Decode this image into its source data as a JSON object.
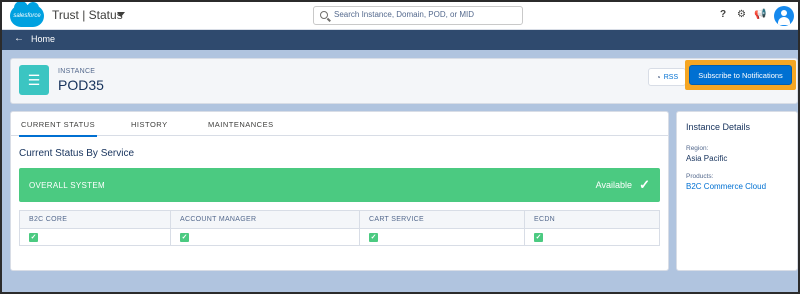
{
  "header": {
    "brand_logo": "salesforce",
    "app_title": "Trust | Status",
    "search_placeholder": "Search Instance, Domain, POD, or MID",
    "icons": [
      "help-icon",
      "gear-icon",
      "megaphone-icon",
      "avatar"
    ]
  },
  "nav": {
    "back_label": "Home"
  },
  "instance": {
    "label": "INSTANCE",
    "name": "POD35",
    "rss_label": "RSS",
    "subscribe_label": "Subscribe to Notifications"
  },
  "tabs": [
    {
      "label": "CURRENT STATUS",
      "active": true
    },
    {
      "label": "HISTORY",
      "active": false
    },
    {
      "label": "MAINTENANCES",
      "active": false
    }
  ],
  "status": {
    "section_title": "Current Status By Service",
    "overall_label": "OVERALL SYSTEM",
    "overall_status": "Available",
    "services": [
      {
        "name": "B2C CORE",
        "ok": true
      },
      {
        "name": "ACCOUNT MANAGER",
        "ok": true
      },
      {
        "name": "CART SERVICE",
        "ok": true
      },
      {
        "name": "ECDN",
        "ok": true
      }
    ]
  },
  "details": {
    "title": "Instance Details",
    "region_label": "Region:",
    "region_value": "Asia Pacific",
    "products_label": "Products:",
    "products_value": "B2C Commerce Cloud"
  },
  "colors": {
    "accent": "#0070d2",
    "available": "#4bca81",
    "highlight": "#f5a623",
    "nav_bar": "#2f4a6e"
  }
}
